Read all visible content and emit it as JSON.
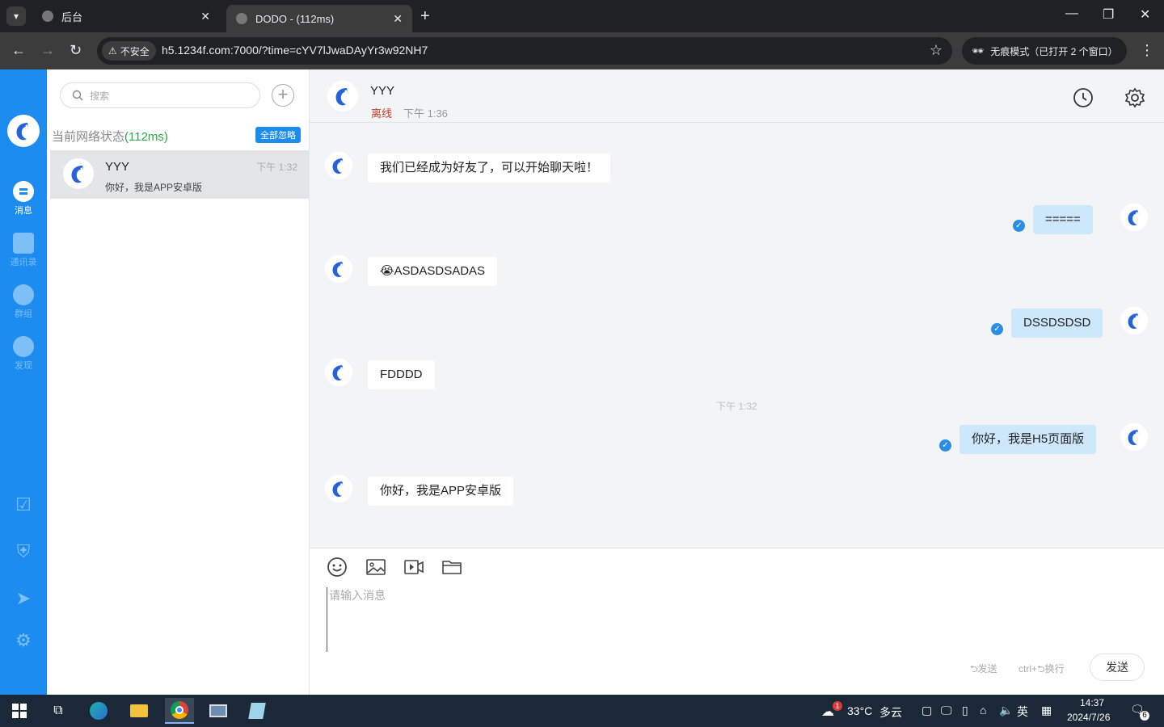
{
  "browser": {
    "tabs": [
      {
        "title": "后台",
        "active": false
      },
      {
        "title": "DODO - (112ms)",
        "active": true
      }
    ],
    "security_label": "不安全",
    "url": "h5.1234f.com:7000/?time=cYV7lJwaDAyYr3w92NH7",
    "incognito_label": "无痕模式（已打开 2 个窗口）"
  },
  "rail": {
    "items": [
      {
        "label": "消息",
        "active": true
      },
      {
        "label": "通讯录",
        "active": false
      },
      {
        "label": "群组",
        "active": false
      },
      {
        "label": "发现",
        "active": false
      }
    ]
  },
  "sidebar": {
    "search_placeholder": "搜索",
    "network_status_label": "当前网络状态",
    "network_latency": "(112ms)",
    "ignore_all_label": "全部忽略",
    "conversations": [
      {
        "name": "YYY",
        "time": "下午 1:32",
        "preview": "你好，我是APP安卓版"
      }
    ]
  },
  "chat": {
    "contact_name": "YYY",
    "status": "离线",
    "last_seen": "下午 1:36",
    "divider_time": "下午 1:32",
    "messages": [
      {
        "text": "我们已经成为好友了，可以开始聊天啦！",
        "mine": false
      },
      {
        "text": "=====",
        "mine": true
      },
      {
        "text": "😭ASDASDSADAS",
        "mine": false
      },
      {
        "text": "DSSDSDSD",
        "mine": true
      },
      {
        "text": "FDDDD",
        "mine": false
      },
      {
        "text": "你好，我是H5页面版",
        "mine": true
      },
      {
        "text": "你好，我是APP安卓版",
        "mine": false
      }
    ],
    "input_placeholder": "请输入消息",
    "hint_send": "⮌发送",
    "hint_newline": "ctrl+⮌换行",
    "send_label": "发送"
  },
  "taskbar": {
    "weather_temp": "33°C",
    "weather_desc": "多云",
    "weather_badge": "1",
    "ime": "英",
    "time": "14:37",
    "date": "2024/7/26",
    "notification_count": "6"
  },
  "colors": {
    "accent": "#1c8cf0",
    "my_bubble": "#cde7fb",
    "offline": "#c0392b",
    "latency": "#2aa84a"
  }
}
